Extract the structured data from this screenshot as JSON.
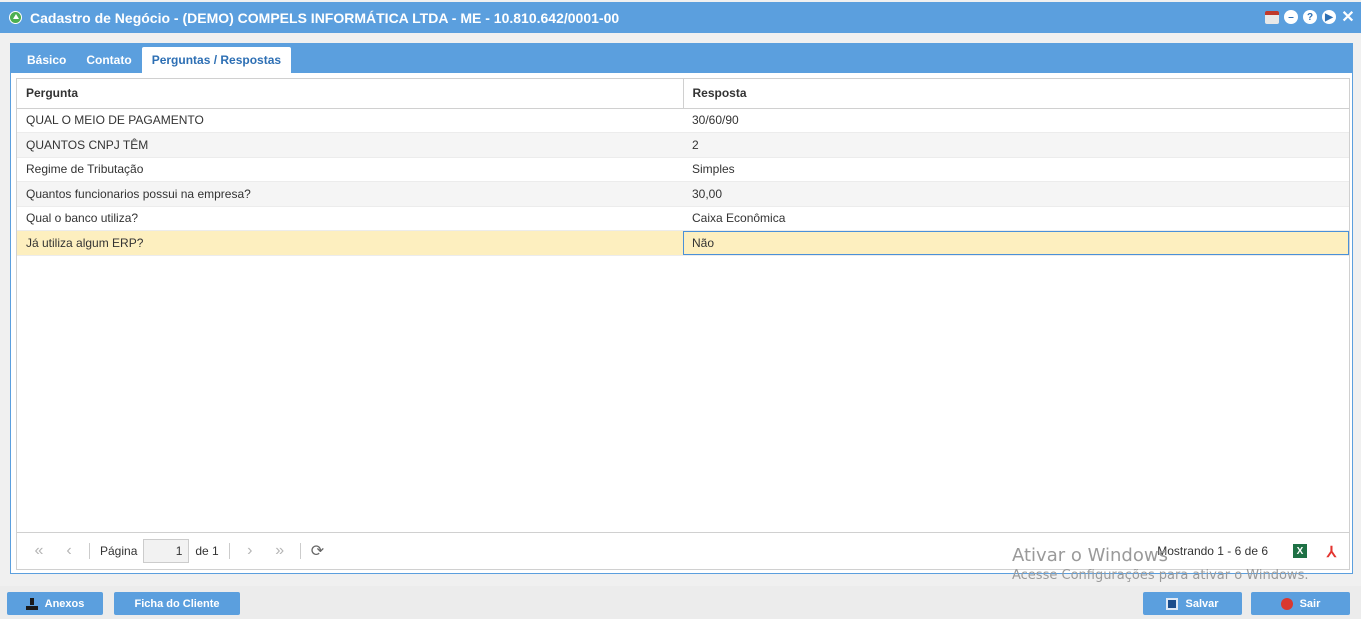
{
  "window": {
    "title": "Cadastro de Negócio - (DEMO) COMPELS INFORMÁTICA LTDA - ME - 10.810.642/0001-00",
    "tools": {
      "help": "?",
      "close": "✕"
    }
  },
  "tabs": [
    {
      "label": "Básico",
      "active": false
    },
    {
      "label": "Contato",
      "active": false
    },
    {
      "label": "Perguntas / Respostas",
      "active": true
    }
  ],
  "grid": {
    "columns": [
      "Pergunta",
      "Resposta"
    ],
    "rows": [
      {
        "pergunta": "QUAL O MEIO DE PAGAMENTO",
        "resposta": "30/60/90"
      },
      {
        "pergunta": "QUANTOS CNPJ TÊM",
        "resposta": "2"
      },
      {
        "pergunta": "Regime de Tributação",
        "resposta": "Simples"
      },
      {
        "pergunta": "Quantos funcionarios possui na empresa?",
        "resposta": "30,00"
      },
      {
        "pergunta": "Qual o banco utiliza?",
        "resposta": "Caixa Econômica"
      },
      {
        "pergunta": "Já utiliza algum ERP?",
        "resposta": "Não"
      }
    ],
    "selected_row": 6
  },
  "pager": {
    "page_label": "Página",
    "page_value": "1",
    "of_label": "de 1",
    "showing": "Mostrando 1 - 6 de 6",
    "export_xls": "X"
  },
  "watermark": {
    "line1": "Ativar o Windows",
    "line2": "Acesse Configurações para ativar o Windows."
  },
  "footer": {
    "anexos": "Anexos",
    "ficha": "Ficha do Cliente",
    "salvar": "Salvar",
    "sair": "Sair"
  }
}
